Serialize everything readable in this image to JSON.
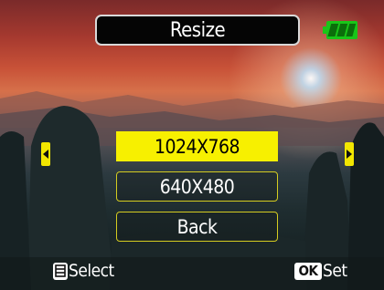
{
  "header": {
    "title": "Resize",
    "battery_icon": "battery-full-icon",
    "battery_color": "#19c619"
  },
  "menu": {
    "items": [
      {
        "label": "1024X768",
        "selected": true
      },
      {
        "label": "640X480",
        "selected": false
      },
      {
        "label": "Back",
        "selected": false
      }
    ],
    "highlight_color": "#f7f000"
  },
  "navigation": {
    "left_icon": "arrow-left-icon",
    "right_icon": "arrow-right-icon"
  },
  "footer": {
    "select_key_icon": "menu-key-icon",
    "select_label": "Select",
    "ok_key": "OK",
    "set_label": "Set"
  }
}
